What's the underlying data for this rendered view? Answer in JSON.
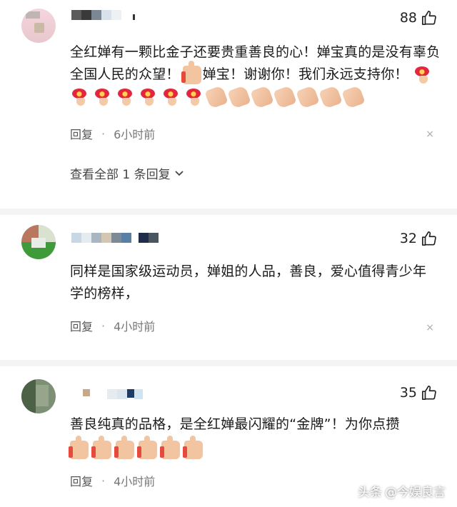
{
  "comments": [
    {
      "likes": "88",
      "text_before": "全红婵有一颗比金子还要贵重善良的心！婵宝真的是没有辜负全国人民的众望！",
      "text_after": "婵宝！谢谢你！我们永远支持你！",
      "reply_label": "回复",
      "dot": "·",
      "time": "6小时前",
      "view_replies": "查看全部 1 条回复"
    },
    {
      "likes": "32",
      "text": "同样是国家级运动员，婵姐的人品，善良，爱心值得青少年学的榜样，",
      "reply_label": "回复",
      "dot": "·",
      "time": "4小时前"
    },
    {
      "likes": "35",
      "text": "善良纯真的品格，是全红婵最闪耀的“金牌”！为你点攒",
      "reply_label": "回复",
      "dot": "·",
      "time": "4小时前"
    }
  ],
  "icons": {
    "like": "thumbs-up-outline-icon",
    "close": "close-icon",
    "chevron": "chevron-down-icon",
    "flower": "bouquet-emoji-icon",
    "clap": "clap-emoji-icon",
    "thumb": "thumbs-up-emoji-icon"
  },
  "close_glyph": "×",
  "watermark": {
    "left": "头条",
    "right": "@今娱良言"
  },
  "colors": {
    "divider": "#f4f4f4",
    "text": "#1a1a1a",
    "meta": "#555555"
  }
}
